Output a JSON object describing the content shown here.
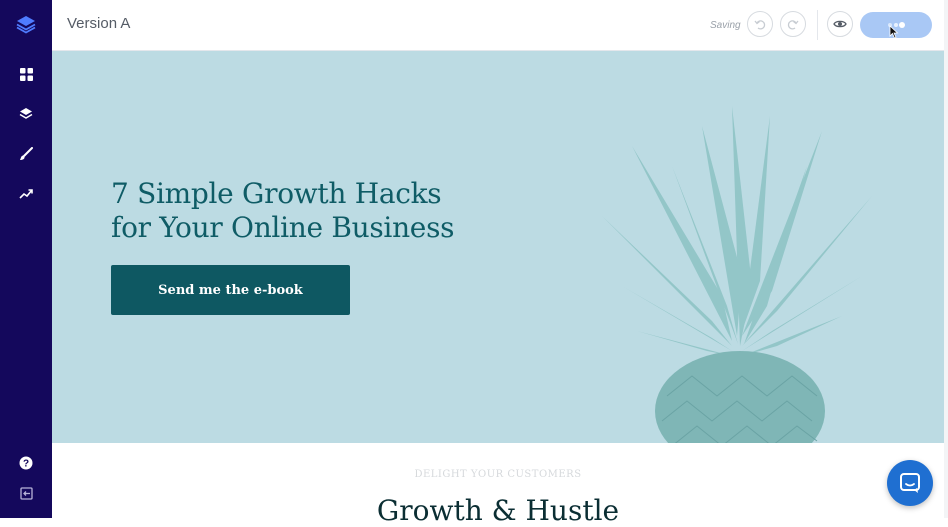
{
  "app": {
    "title": "Version A",
    "status": "Saving"
  },
  "sidebar": {
    "items": [
      {
        "icon": "layers-logo-icon"
      },
      {
        "icon": "grid-icon"
      },
      {
        "icon": "stack-icon"
      },
      {
        "icon": "brush-icon"
      },
      {
        "icon": "trend-icon"
      },
      {
        "icon": "help-icon"
      },
      {
        "icon": "exit-icon"
      }
    ]
  },
  "hero": {
    "title_line1": "7 Simple Growth Hacks",
    "title_line2": "for Your Online Business",
    "cta_label": "Send me the e-book"
  },
  "section": {
    "eyebrow": "DELIGHT YOUR CUSTOMERS",
    "title": "Growth & Hustle"
  },
  "colors": {
    "sidebar": "#14085c",
    "hero_bg": "#bcdbe3",
    "accent": "#0e5862",
    "publish": "#a9c8f5",
    "chat": "#1f6fd1"
  }
}
